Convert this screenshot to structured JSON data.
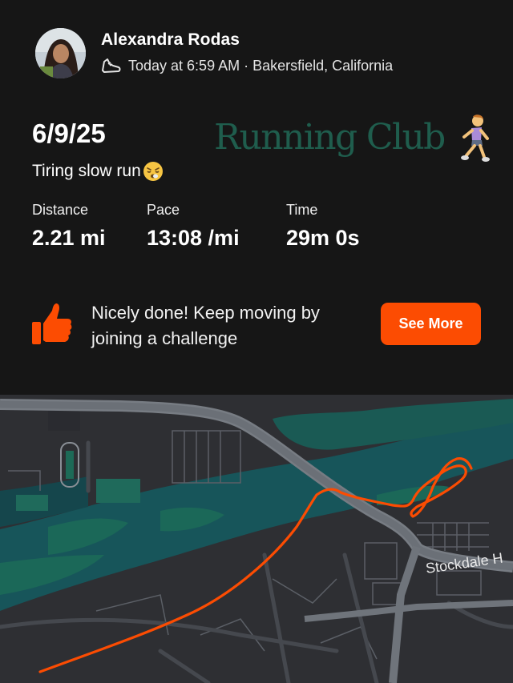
{
  "header": {
    "user_name": "Alexandra Rodas",
    "meta_text": "Today at 6:59 AM · Bakersfield, California"
  },
  "activity": {
    "date": "6/9/25",
    "overlay_text": "Running Club",
    "description": "Tiring slow run",
    "stats": [
      {
        "label": "Distance",
        "value": "2.21 mi"
      },
      {
        "label": "Pace",
        "value": "13:08 /mi"
      },
      {
        "label": "Time",
        "value": "29m 0s"
      }
    ]
  },
  "prompt": {
    "text": "Nicely done! Keep moving by joining a challenge",
    "button_label": "See More"
  },
  "map": {
    "street_label": "Stockdale H"
  },
  "colors": {
    "accent": "#fc4c02",
    "overlay_green": "#1f5d4d",
    "map_background": "#2e2f33",
    "map_water": "#17555a"
  },
  "icons": [
    "shoe-icon",
    "thumbs-up-icon",
    "runner-emoji-icon",
    "tired-face-emoji-icon"
  ]
}
